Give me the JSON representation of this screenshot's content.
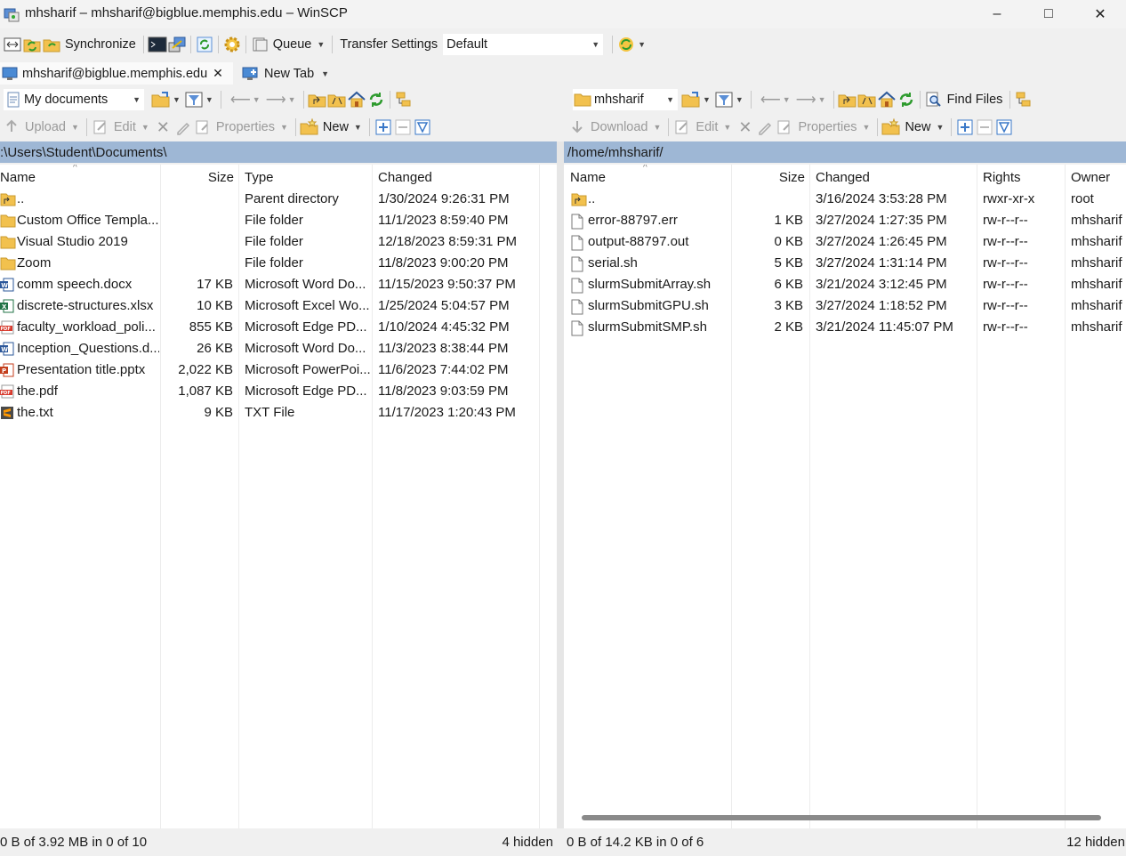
{
  "window": {
    "title": "mhsharif – mhsharif@bigblue.memphis.edu – WinSCP",
    "minimize": "–",
    "maximize": "□",
    "close": "✕"
  },
  "toolbar": {
    "synchronize": "Synchronize",
    "queue": "Queue",
    "transfer_settings_label": "Transfer Settings",
    "transfer_settings_value": "Default"
  },
  "tabs": [
    {
      "label": "mhsharif@bigblue.memphis.edu",
      "close": "✕"
    },
    {
      "label": "New Tab"
    }
  ],
  "left": {
    "location": "My documents",
    "actions": {
      "upload": "Upload",
      "edit": "Edit",
      "properties": "Properties",
      "new": "New"
    },
    "path": ":\\Users\\Student\\Documents\\",
    "columns": {
      "name": "Name",
      "size": "Size",
      "type": "Type",
      "changed": "Changed"
    },
    "files": [
      {
        "icon": "parent-folder-icon",
        "name": "..",
        "size": "",
        "type": "Parent directory",
        "changed": "1/30/2024 9:26:31 PM"
      },
      {
        "icon": "folder-icon",
        "name": "Custom Office Templa...",
        "size": "",
        "type": "File folder",
        "changed": "11/1/2023 8:59:40 PM"
      },
      {
        "icon": "folder-icon",
        "name": "Visual Studio 2019",
        "size": "",
        "type": "File folder",
        "changed": "12/18/2023 8:59:31 PM"
      },
      {
        "icon": "folder-icon",
        "name": "Zoom",
        "size": "",
        "type": "File folder",
        "changed": "11/8/2023 9:00:20 PM"
      },
      {
        "icon": "word-doc-icon",
        "name": "comm speech.docx",
        "size": "17 KB",
        "type": "Microsoft Word Do...",
        "changed": "11/15/2023 9:50:37 PM"
      },
      {
        "icon": "excel-icon",
        "name": "discrete-structures.xlsx",
        "size": "10 KB",
        "type": "Microsoft Excel Wo...",
        "changed": "1/25/2024 5:04:57 PM"
      },
      {
        "icon": "pdf-icon",
        "name": "faculty_workload_poli...",
        "size": "855 KB",
        "type": "Microsoft Edge PD...",
        "changed": "1/10/2024 4:45:32 PM"
      },
      {
        "icon": "word-doc-icon",
        "name": "Inception_Questions.d...",
        "size": "26 KB",
        "type": "Microsoft Word Do...",
        "changed": "11/3/2023 8:38:44 PM"
      },
      {
        "icon": "powerpoint-icon",
        "name": "Presentation title.pptx",
        "size": "2,022 KB",
        "type": "Microsoft PowerPoi...",
        "changed": "11/6/2023 7:44:02 PM"
      },
      {
        "icon": "pdf-icon",
        "name": "the.pdf",
        "size": "1,087 KB",
        "type": "Microsoft Edge PD...",
        "changed": "11/8/2023 9:03:59 PM"
      },
      {
        "icon": "sublime-text-icon",
        "name": "the.txt",
        "size": "9 KB",
        "type": "TXT File",
        "changed": "11/17/2023 1:20:43 PM"
      }
    ],
    "status": "0 B of 3.92 MB in 0 of 10",
    "hidden": "4 hidden"
  },
  "right": {
    "location": "mhsharif",
    "find_files": "Find Files",
    "actions": {
      "download": "Download",
      "edit": "Edit",
      "properties": "Properties",
      "new": "New"
    },
    "path": "/home/mhsharif/",
    "columns": {
      "name": "Name",
      "size": "Size",
      "changed": "Changed",
      "rights": "Rights",
      "owner": "Owner"
    },
    "files": [
      {
        "icon": "parent-folder-icon",
        "name": "..",
        "size": "",
        "changed": "3/16/2024 3:53:28 PM",
        "rights": "rwxr-xr-x",
        "owner": "root"
      },
      {
        "icon": "file-icon",
        "name": "error-88797.err",
        "size": "1 KB",
        "changed": "3/27/2024 1:27:35 PM",
        "rights": "rw-r--r--",
        "owner": "mhsharif"
      },
      {
        "icon": "file-icon",
        "name": "output-88797.out",
        "size": "0 KB",
        "changed": "3/27/2024 1:26:45 PM",
        "rights": "rw-r--r--",
        "owner": "mhsharif"
      },
      {
        "icon": "file-icon",
        "name": "serial.sh",
        "size": "5 KB",
        "changed": "3/27/2024 1:31:14 PM",
        "rights": "rw-r--r--",
        "owner": "mhsharif"
      },
      {
        "icon": "file-icon",
        "name": "slurmSubmitArray.sh",
        "size": "6 KB",
        "changed": "3/21/2024 3:12:45 PM",
        "rights": "rw-r--r--",
        "owner": "mhsharif"
      },
      {
        "icon": "file-icon",
        "name": "slurmSubmitGPU.sh",
        "size": "3 KB",
        "changed": "3/27/2024 1:18:52 PM",
        "rights": "rw-r--r--",
        "owner": "mhsharif"
      },
      {
        "icon": "file-icon",
        "name": "slurmSubmitSMP.sh",
        "size": "2 KB",
        "changed": "3/21/2024 11:45:07 PM",
        "rights": "rw-r--r--",
        "owner": "mhsharif"
      }
    ],
    "status": "0 B of 14.2 KB in 0 of 6",
    "hidden": "12 hidden"
  }
}
